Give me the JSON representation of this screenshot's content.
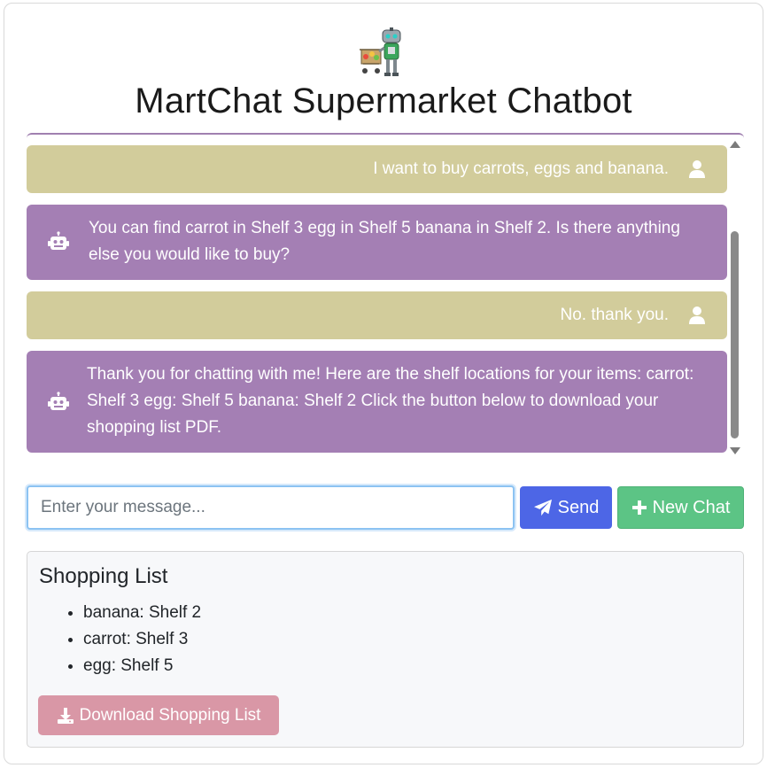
{
  "header": {
    "logo_icon": "robot-shopping-cart-icon",
    "title": "MartChat Supermarket Chatbot"
  },
  "messages": [
    {
      "role": "user",
      "text": "I want to buy carrots, eggs and banana.",
      "icon": "user-icon"
    },
    {
      "role": "bot",
      "text": "You can find carrot in Shelf 3 egg in Shelf 5 banana in Shelf 2. Is there anything else you would like to buy?",
      "icon": "robot-icon"
    },
    {
      "role": "user",
      "text": "No. thank you.",
      "icon": "user-icon"
    },
    {
      "role": "bot",
      "text": "Thank you for chatting with me! Here are the shelf locations for your items: carrot: Shelf 3 egg: Shelf 5 banana: Shelf 2 Click the button below to download your shopping list PDF.",
      "icon": "robot-icon"
    }
  ],
  "input": {
    "placeholder": "Enter your message...",
    "value": ""
  },
  "buttons": {
    "send_label": "Send",
    "send_icon": "paper-plane-icon",
    "new_chat_label": "New Chat",
    "new_chat_icon": "plus-icon"
  },
  "shopping_list": {
    "title": "Shopping List",
    "items": [
      "banana: Shelf 2",
      "carrot: Shelf 3",
      "egg: Shelf 5"
    ],
    "download_label": "Download Shopping List",
    "download_icon": "download-icon"
  },
  "colors": {
    "user_bubble": "#d2cc9b",
    "bot_bubble": "#a47fb4",
    "send_button": "#4d66e6",
    "new_chat_button": "#5cc485",
    "download_button": "#d997a6"
  }
}
